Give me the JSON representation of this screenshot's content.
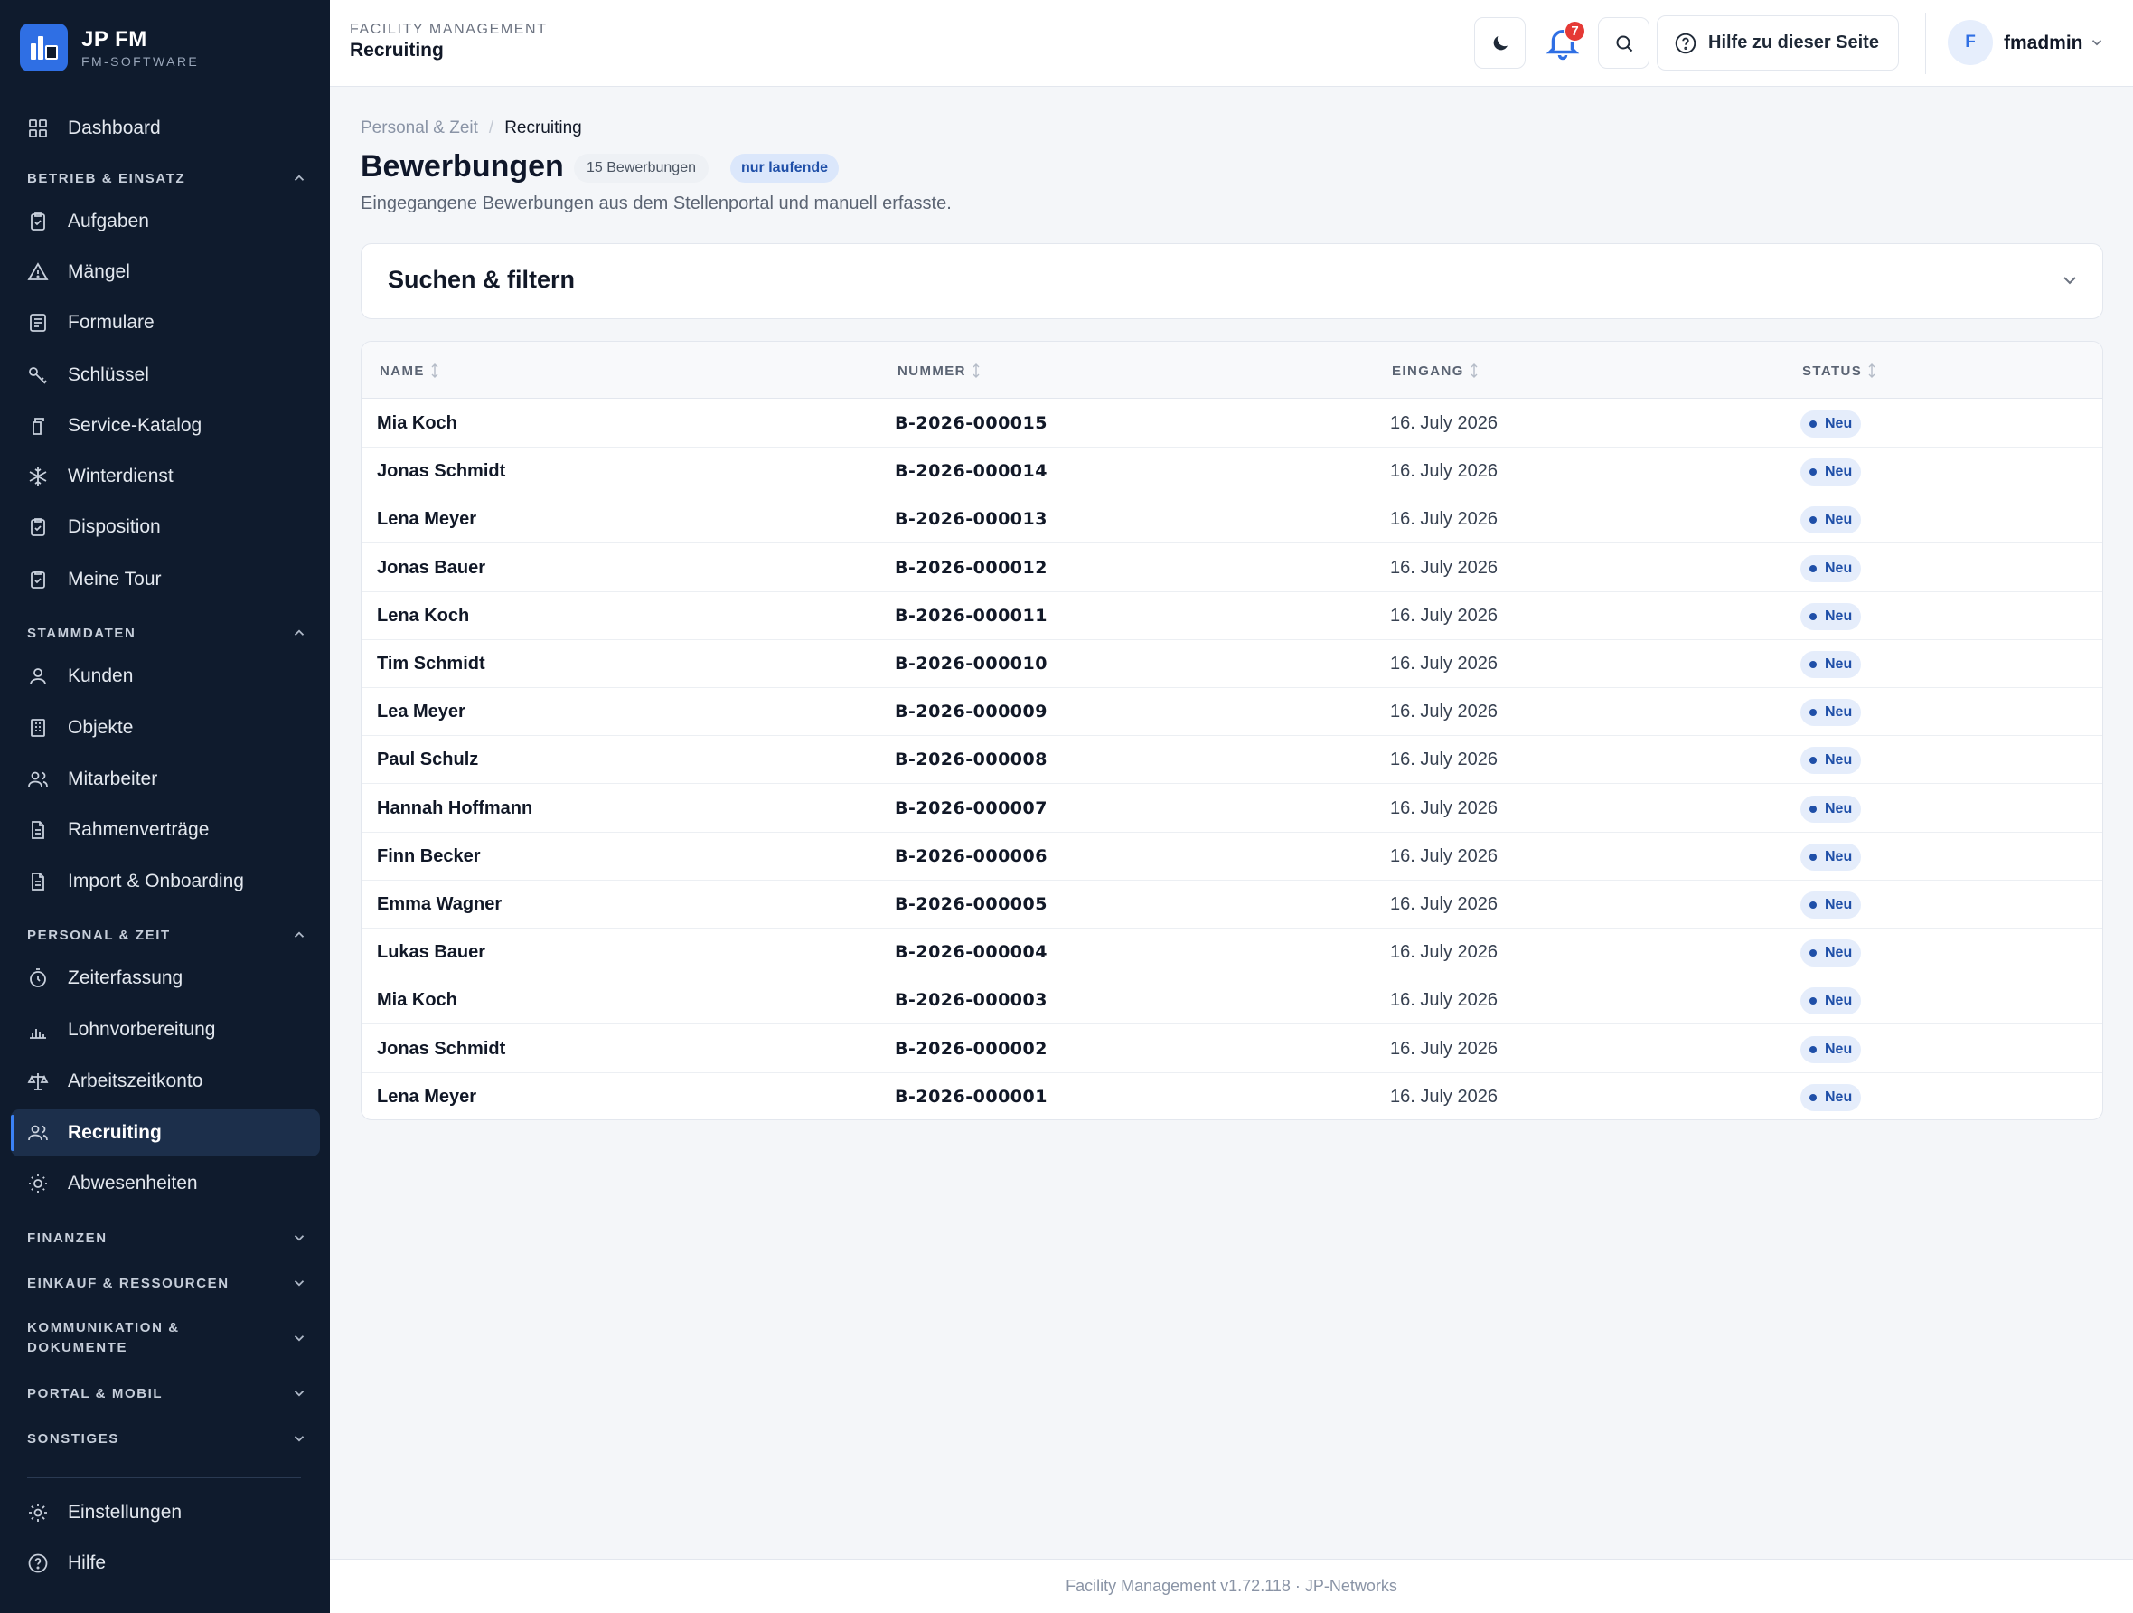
{
  "brand": {
    "name": "JP FM",
    "subtitle": "FM-SOFTWARE"
  },
  "sidebar": {
    "dashboard": "Dashboard",
    "sections": {
      "betrieb": "BETRIEB & EINSATZ",
      "stammdaten": "STAMMDATEN",
      "personal": "PERSONAL & ZEIT",
      "finanzen": "FINANZEN",
      "einkauf": "EINKAUF & RESSOURCEN",
      "kommunikation_line1": "KOMMUNIKATION &",
      "kommunikation_line2": "DOKUMENTE",
      "portal": "PORTAL & MOBIL",
      "sonstiges": "SONSTIGES"
    },
    "betrieb_items": [
      "Aufgaben",
      "Mängel",
      "Formulare",
      "Schlüssel",
      "Service-Katalog",
      "Winterdienst",
      "Disposition",
      "Meine Tour"
    ],
    "stammdaten_items": [
      "Kunden",
      "Objekte",
      "Mitarbeiter",
      "Rahmenverträge",
      "Import & Onboarding"
    ],
    "personal_items": [
      "Zeiterfassung",
      "Lohnvorbereitung",
      "Arbeitszeitkonto",
      "Recruiting",
      "Abwesenheiten"
    ],
    "bottom_items": [
      "Einstellungen",
      "Hilfe"
    ],
    "active": "Recruiting"
  },
  "topbar": {
    "section": "FACILITY MANAGEMENT",
    "title": "Recruiting",
    "notification_count": "7",
    "help_label": "Hilfe zu dieser Seite",
    "user_initial": "F",
    "user_name": "fmadmin"
  },
  "breadcrumb": {
    "parent": "Personal & Zeit",
    "separator": "/",
    "current": "Recruiting"
  },
  "page": {
    "title": "Bewerbungen",
    "count_badge": "15 Bewerbungen",
    "filter_badge": "nur laufende",
    "subtitle": "Eingegangene Bewerbungen aus dem Stellenportal und manuell erfasste."
  },
  "filter": {
    "title": "Suchen & filtern"
  },
  "table": {
    "columns": [
      "NAME",
      "NUMMER",
      "EINGANG",
      "STATUS"
    ],
    "rows": [
      {
        "name": "Mia Koch",
        "number": "B-2026-000015",
        "date": "16. July 2026",
        "status": "Neu"
      },
      {
        "name": "Jonas Schmidt",
        "number": "B-2026-000014",
        "date": "16. July 2026",
        "status": "Neu"
      },
      {
        "name": "Lena Meyer",
        "number": "B-2026-000013",
        "date": "16. July 2026",
        "status": "Neu"
      },
      {
        "name": "Jonas Bauer",
        "number": "B-2026-000012",
        "date": "16. July 2026",
        "status": "Neu"
      },
      {
        "name": "Lena Koch",
        "number": "B-2026-000011",
        "date": "16. July 2026",
        "status": "Neu"
      },
      {
        "name": "Tim Schmidt",
        "number": "B-2026-000010",
        "date": "16. July 2026",
        "status": "Neu"
      },
      {
        "name": "Lea Meyer",
        "number": "B-2026-000009",
        "date": "16. July 2026",
        "status": "Neu"
      },
      {
        "name": "Paul Schulz",
        "number": "B-2026-000008",
        "date": "16. July 2026",
        "status": "Neu"
      },
      {
        "name": "Hannah Hoffmann",
        "number": "B-2026-000007",
        "date": "16. July 2026",
        "status": "Neu"
      },
      {
        "name": "Finn Becker",
        "number": "B-2026-000006",
        "date": "16. July 2026",
        "status": "Neu"
      },
      {
        "name": "Emma Wagner",
        "number": "B-2026-000005",
        "date": "16. July 2026",
        "status": "Neu"
      },
      {
        "name": "Lukas Bauer",
        "number": "B-2026-000004",
        "date": "16. July 2026",
        "status": "Neu"
      },
      {
        "name": "Mia Koch",
        "number": "B-2026-000003",
        "date": "16. July 2026",
        "status": "Neu"
      },
      {
        "name": "Jonas Schmidt",
        "number": "B-2026-000002",
        "date": "16. July 2026",
        "status": "Neu"
      },
      {
        "name": "Lena Meyer",
        "number": "B-2026-000001",
        "date": "16. July 2026",
        "status": "Neu"
      }
    ]
  },
  "footer": {
    "text": "Facility Management v1.72.118 · JP-Networks"
  },
  "colors": {
    "sidebar_bg": "#0f1b2d",
    "accent": "#2f6fe4",
    "badge_red": "#e53935"
  }
}
